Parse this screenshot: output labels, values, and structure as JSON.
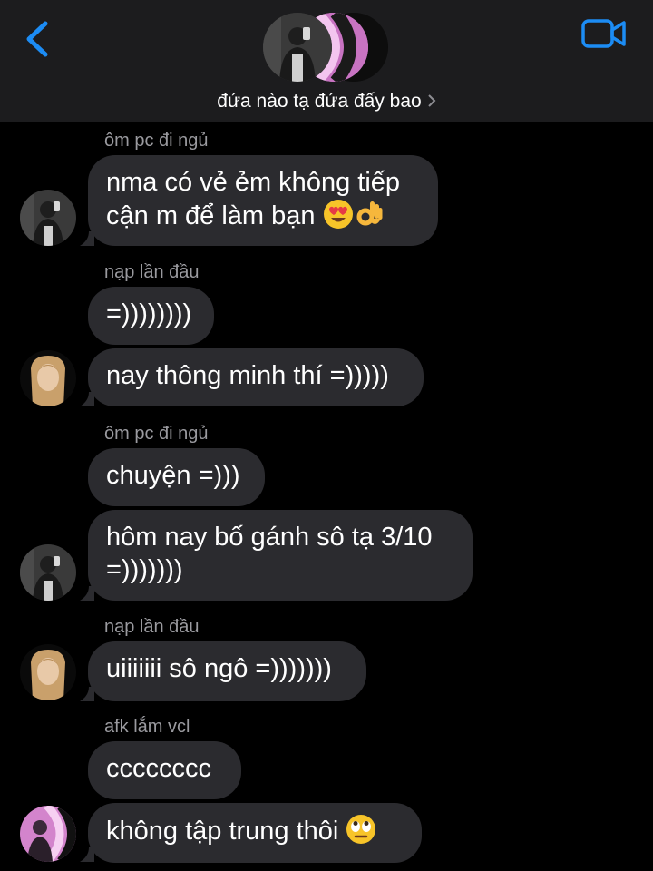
{
  "header": {
    "group_name": "đứa nào tạ đứa đấy bao",
    "accent_color": "#1c8cf4",
    "back_icon": "chevron-left-icon",
    "video_icon": "video-camera-icon"
  },
  "messages": [
    {
      "sender": "ôm pc đi ngủ",
      "text_lines": [
        "nma có vẻ ẻm không tiếp",
        "cận m để làm bạn"
      ],
      "emojis": [
        "heart-eyes-emoji",
        "ok-hand-emoji"
      ]
    },
    {
      "sender": "nạp lần đầu",
      "text_lines": [
        "=))))))))"
      ]
    },
    {
      "text_lines": [
        "nay thông minh thí =)))))"
      ]
    },
    {
      "sender": "ôm pc đi ngủ",
      "text_lines": [
        "chuyện =)))"
      ]
    },
    {
      "text_lines": [
        "hôm nay bố gánh sô tạ 3/10",
        "=)))))))"
      ]
    },
    {
      "sender": "nạp lần đầu",
      "text_lines": [
        "uiiiiiii sô ngô =)))))))"
      ]
    },
    {
      "sender": "afk lắm vcl",
      "text_lines": [
        "cccccccc"
      ]
    },
    {
      "text_lines": [
        "không tập trung thôi"
      ],
      "emojis": [
        "eye-roll-emoji"
      ]
    }
  ],
  "colors": {
    "background": "#000000",
    "header_bg": "#1c1c1e",
    "bubble_bg": "#2b2b2f",
    "sender_text": "#9a9a9f"
  }
}
